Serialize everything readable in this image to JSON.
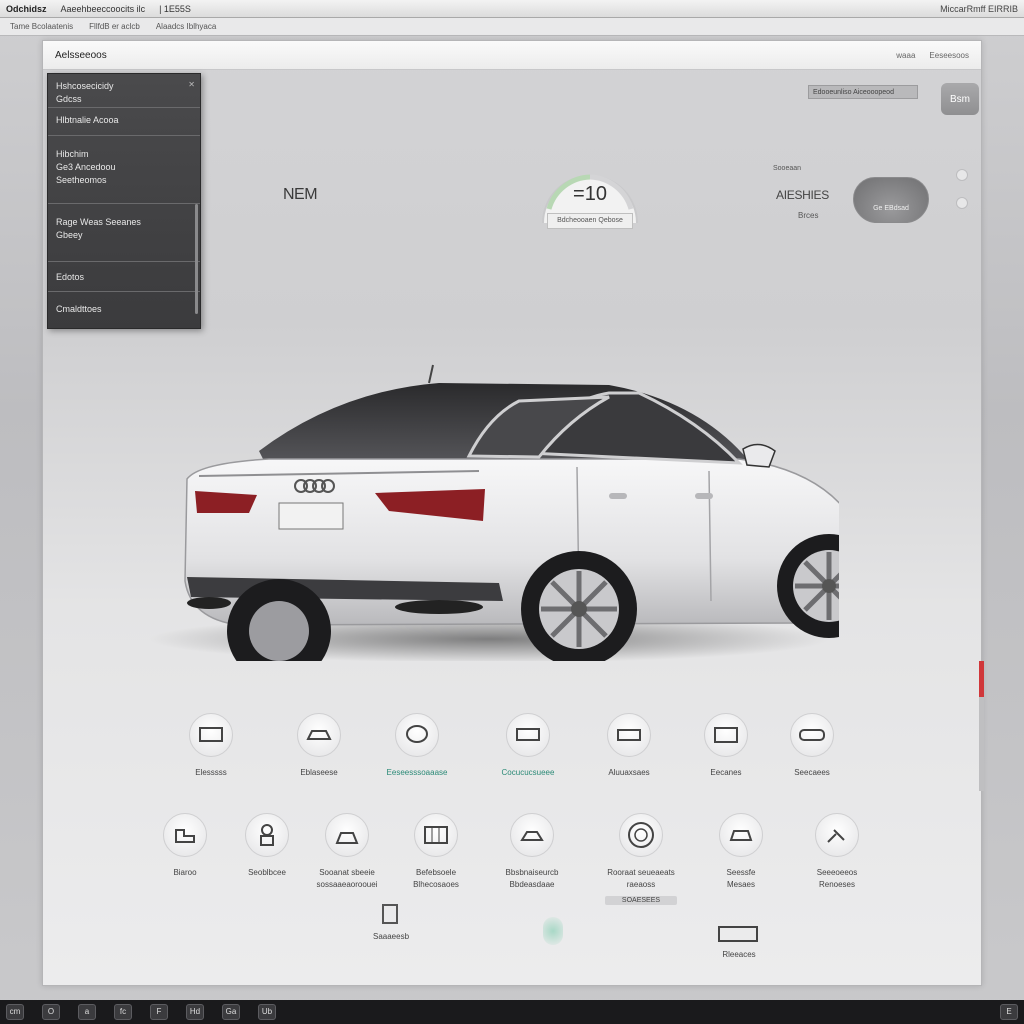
{
  "os_bar": {
    "app_name": "Odchidsz",
    "address": "Aaeehbeeccoocits  ilc",
    "page": "| 1E55S",
    "right": "MiccarRmff EIRRIB"
  },
  "menu_bar": {
    "items": [
      "Tame  Bcolaatenis",
      "FllfdB  er  aclcb",
      "Alaadcs  Iblhyaca"
    ]
  },
  "window": {
    "title": "Aelsseeoos",
    "btn_a": "waaa",
    "btn_b": "Eeseesoos"
  },
  "sidebar": {
    "section1": [
      "Hshcosecicidy",
      "Gdcss"
    ],
    "section2": [
      "Hlbtnalie Acooa"
    ],
    "section3": [
      "Hibchim",
      "Ge3 Ancedoou",
      "Seetheomos"
    ],
    "section4": [
      "Rage Weas Seeanes",
      "Gbeey"
    ],
    "section5": [
      "Edotos"
    ],
    "section6": [
      "Cmaldttoes"
    ]
  },
  "search": {
    "value": "Edooeunliso Aiceooopeod"
  },
  "corner_button": "Bsm",
  "heading": "NEM",
  "gauge": {
    "value": "=10",
    "label": "Bdcheooaen Qebose"
  },
  "stats": {
    "small": "Sooeaan",
    "label": "AIESHIES",
    "sub": "Brces",
    "pill": "Ge EBdsad"
  },
  "features_row1": [
    {
      "label": "Elesssss"
    },
    {
      "label": "Eblaseese"
    },
    {
      "label": "Eeseesssoaaase"
    },
    {
      "label": "Cocucucsueee"
    },
    {
      "label": "Aluuaxsaes"
    },
    {
      "label": "Eecanes"
    },
    {
      "label": "Seecaees"
    }
  ],
  "features_row2": [
    {
      "label": "Biaroo",
      "sub": ""
    },
    {
      "label": "Seoblbcee",
      "sub": ""
    },
    {
      "label": "Sooanat sbeeie",
      "sub": "sossaaeaoroouei"
    },
    {
      "label": "Befebsoele",
      "sub": "Blhecosaoes"
    },
    {
      "label": "Bbsbnaiseurcb",
      "sub": "Bbdeasdaae"
    },
    {
      "label": "Rooraat seueaeats",
      "sub": "raeaoss",
      "pill": "SOAESEES"
    },
    {
      "label": "Seessfe",
      "sub": "Mesaes"
    },
    {
      "label": "Seeeoeeos",
      "sub": "Renoeses"
    }
  ],
  "features_row3": [
    {
      "label": "Saaaeesb"
    },
    {
      "label": "Rleeaces"
    }
  ],
  "taskbar": {
    "items": [
      "cm",
      "O",
      "a",
      "fc",
      "F",
      "Hd",
      "Ga",
      "Ub",
      "E"
    ]
  }
}
